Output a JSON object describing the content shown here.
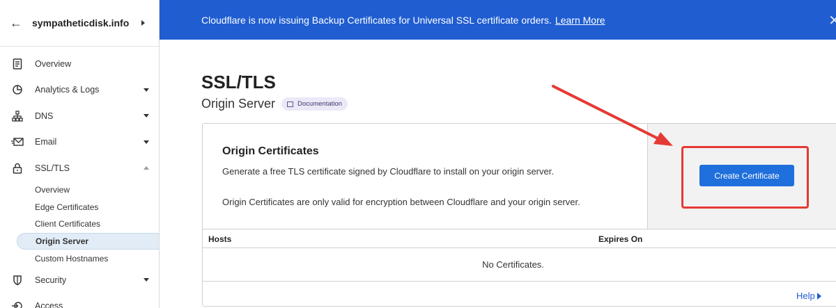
{
  "sidebar": {
    "domain": "sympatheticdisk.info",
    "items": [
      {
        "label": "Overview",
        "icon": "document-icon"
      },
      {
        "label": "Analytics & Logs",
        "icon": "clock-chart-icon"
      },
      {
        "label": "DNS",
        "icon": "network-icon"
      },
      {
        "label": "Email",
        "icon": "email-icon"
      },
      {
        "label": "SSL/TLS",
        "icon": "lock-icon"
      }
    ],
    "sub_items": [
      "Overview",
      "Edge Certificates",
      "Client Certificates",
      "Origin Server",
      "Custom Hostnames"
    ],
    "after_items": [
      {
        "label": "Security",
        "icon": "shield-icon"
      },
      {
        "label": "Access",
        "icon": "access-icon"
      }
    ]
  },
  "banner": {
    "text": "Cloudflare is now issuing Backup Certificates for Universal SSL certificate orders.",
    "link": "Learn More"
  },
  "page": {
    "title": "SSL/TLS",
    "subtitle": "Origin Server",
    "doc_badge": "Documentation"
  },
  "card": {
    "title": "Origin Certificates",
    "desc1": "Generate a free TLS certificate signed by Cloudflare to install on your origin server.",
    "desc2": "Origin Certificates are only valid for encryption between Cloudflare and your origin server.",
    "button": "Create Certificate",
    "col_hosts": "Hosts",
    "col_expires": "Expires On",
    "empty": "No Certificates.",
    "help": "Help"
  },
  "colors": {
    "banner": "#1f5dd1",
    "button": "#1f6fdc",
    "annotation": "#e53935"
  }
}
